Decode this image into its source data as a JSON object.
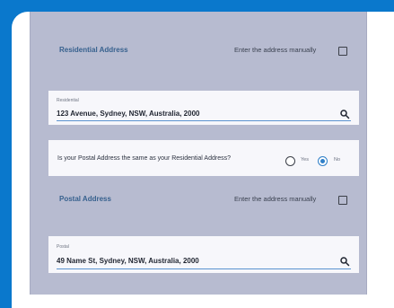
{
  "residential": {
    "section_title": "Residential Address",
    "manual_label": "Enter the address manually",
    "field_label": "Residential",
    "field_value": "123 Avenue, Sydney, NSW, Australia, 2000"
  },
  "postal_question": {
    "text": "Is your Postal Address the same as your Residential Address?",
    "yes_label": "Yes",
    "no_label": "No",
    "selected": "No"
  },
  "postal": {
    "section_title": "Postal Address",
    "manual_label": "Enter the address manually",
    "field_label": "Postal",
    "field_value": "49 Name St, Sydney, NSW, Australia, 2000"
  },
  "icons": {
    "search": "search-icon",
    "checkbox": "checkbox-icon",
    "radio": "radio-button"
  },
  "colors": {
    "page_background": "#0a78cc",
    "panel_background": "#b7bbd0",
    "accent": "#2f7fc8",
    "section_title": "#37618e"
  }
}
